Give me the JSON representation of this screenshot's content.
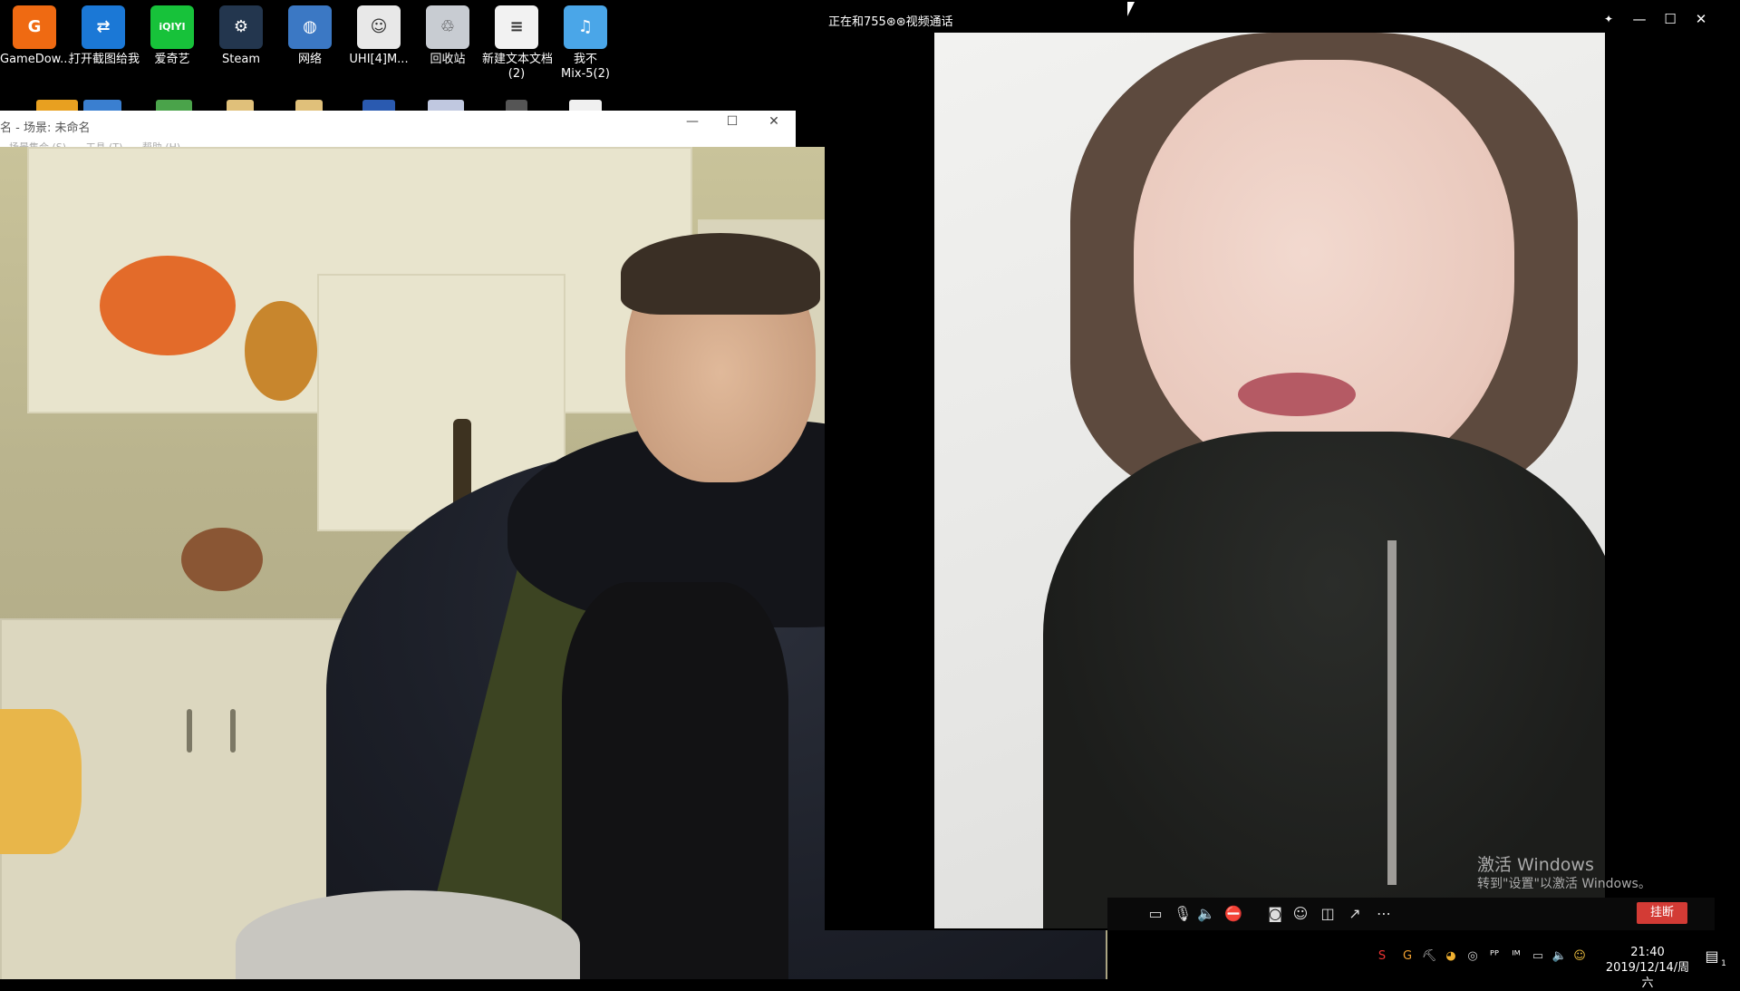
{
  "desktop": {
    "icons": [
      {
        "label": "GameDow...",
        "glyph": "G",
        "color": "#ef6a12"
      },
      {
        "label": "打开截图给我",
        "glyph": "⇄",
        "color": "#1b78d6"
      },
      {
        "label": "爱奇艺",
        "glyph": "iQIYI",
        "color": "#17c23a"
      },
      {
        "label": "Steam",
        "glyph": "⚙",
        "color": "#23364e"
      },
      {
        "label": "网络",
        "glyph": "◍",
        "color": "#3b78c4"
      },
      {
        "label": "UHI[4]M...",
        "glyph": "☺",
        "color": "#e8e8e8"
      },
      {
        "label": "回收站",
        "glyph": "♲",
        "color": "#c8ccd2"
      },
      {
        "label": "新建文本文档\n(2)",
        "glyph": "≡",
        "color": "#f2f2f2"
      },
      {
        "label": "我不\nMix-5(2)",
        "glyph": "♫",
        "color": "#4aa6e8"
      }
    ]
  },
  "bg_window": {
    "title": "名 - 场景: 未命名",
    "menu": [
      "场景集合 (S)",
      "工具 (T)",
      "帮助 (H)"
    ],
    "minimize": "—",
    "maximize": "☐",
    "close": "✕"
  },
  "call_window": {
    "title": "正在和755⊛⊛视频通话",
    "pin": "✦",
    "minimize": "—",
    "maximize": "☐",
    "close": "✕",
    "controls": [
      {
        "name": "chat-icon",
        "glyph": "▭"
      },
      {
        "name": "microphone-icon",
        "glyph": "🎙"
      },
      {
        "name": "speaker-icon",
        "glyph": "🔈"
      },
      {
        "name": "camera-off-icon",
        "glyph": "⛔"
      },
      {
        "name": "snapshot-icon",
        "glyph": "◙"
      },
      {
        "name": "effects-icon",
        "glyph": "☺"
      },
      {
        "name": "layout-icon",
        "glyph": "◫"
      },
      {
        "name": "share-icon",
        "glyph": "↗"
      },
      {
        "name": "more-icon",
        "glyph": "⋯"
      }
    ],
    "hangup_label": "挂断"
  },
  "watermark": {
    "line1": "激活 Windows",
    "line2": "转到\"设置\"以激活 Windows。"
  },
  "taskbar": {
    "tray_icons": [
      "S",
      "G",
      "⛏",
      "◕",
      "◎",
      "ᴾᴾ",
      "ᴵᴹ",
      "▭",
      "🔈",
      "☺"
    ],
    "time": "21:40",
    "date": "2019/12/14/周六",
    "notifications_icon": "▤",
    "notifications_count": "1"
  }
}
